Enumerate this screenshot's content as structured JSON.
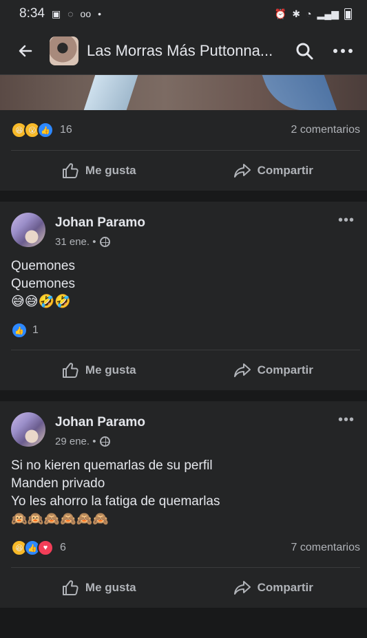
{
  "status": {
    "time": "8:34",
    "right_icons": [
      "alarm-icon",
      "bluetooth-icon",
      "wifi-icon",
      "signal-icon",
      "battery-icon"
    ]
  },
  "appbar": {
    "title": "Las Morras Más Puttonna..."
  },
  "posts": [
    {
      "reaction_count": "16",
      "comments": "2 comentarios",
      "like_label": "Me gusta",
      "share_label": "Compartir"
    },
    {
      "author": "Johan Paramo",
      "date": "31 ene. •",
      "text": [
        "Quemones",
        "Quemones",
        "😅😅🤣🤣"
      ],
      "reaction_count": "1",
      "like_label": "Me gusta",
      "share_label": "Compartir"
    },
    {
      "author": "Johan Paramo",
      "date": "29 ene. •",
      "text": [
        "Si no kieren quemarlas de su perfil",
        "Manden privado",
        "Yo les ahorro la fatiga de quemarlas",
        "🙉🙉🙈🙈🙈🙈"
      ],
      "reaction_count": "6",
      "comments": "7 comentarios",
      "like_label": "Me gusta",
      "share_label": "Compartir"
    }
  ]
}
